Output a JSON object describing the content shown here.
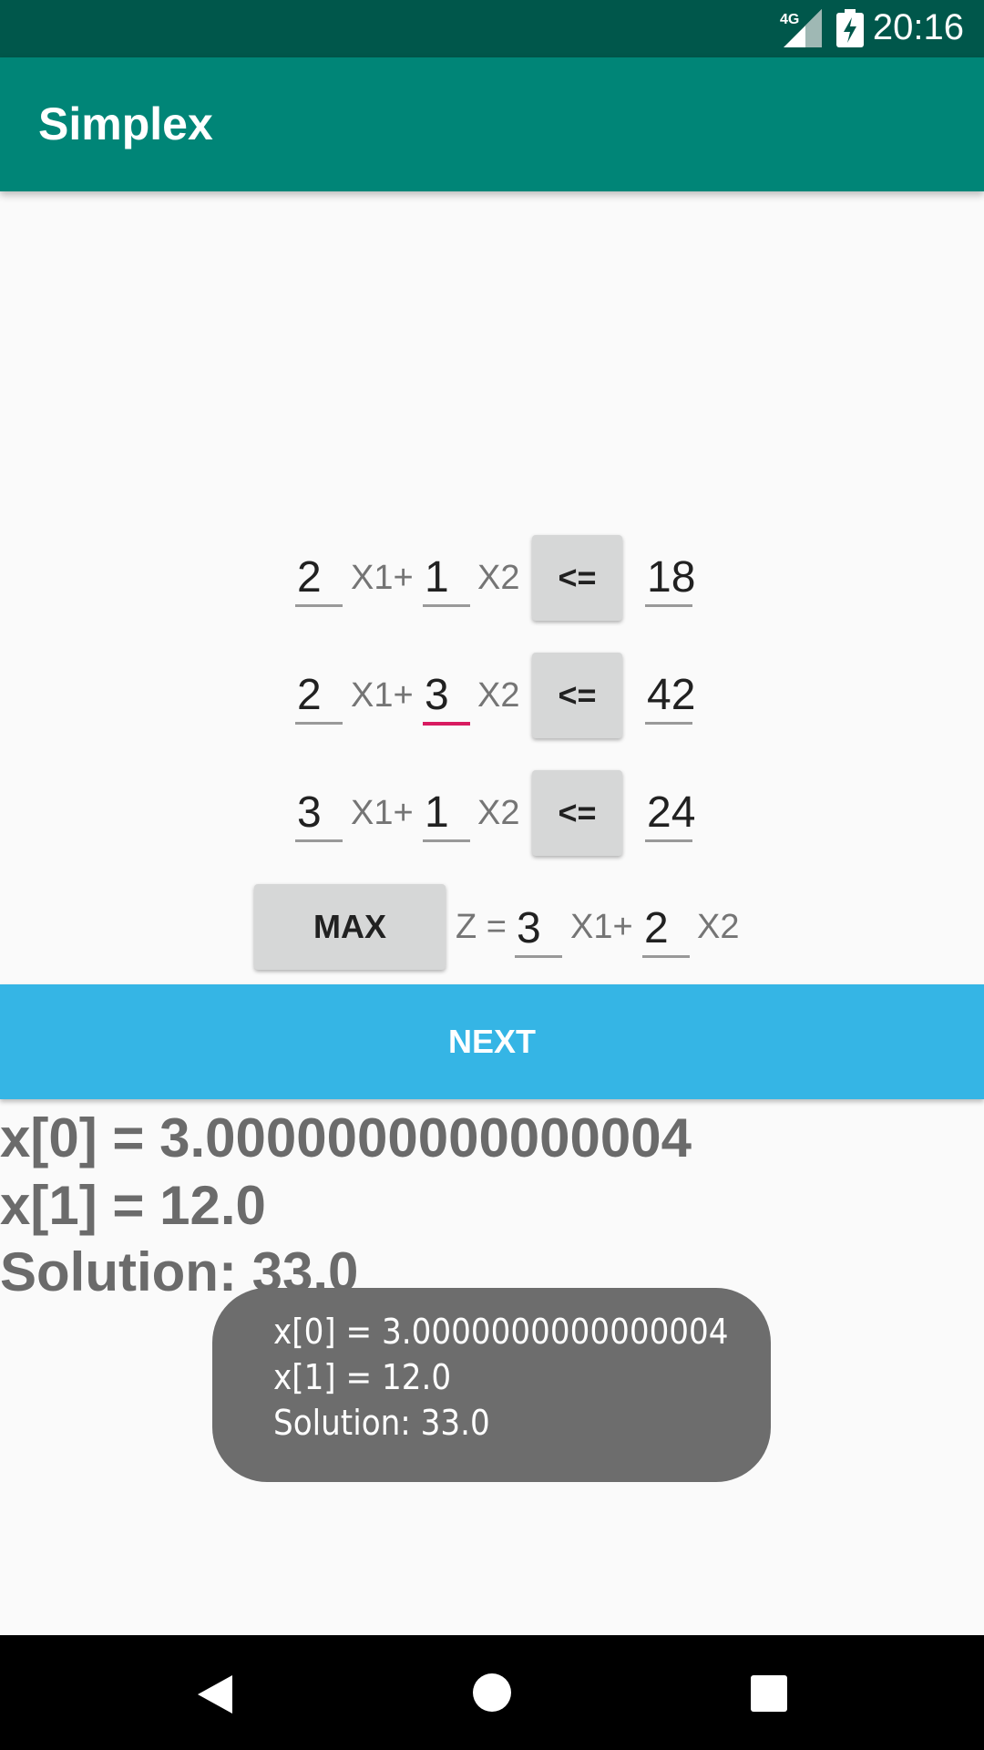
{
  "status_bar": {
    "network": "4G",
    "time": "20:16",
    "icons": [
      "signal-icon",
      "battery-charging-icon"
    ]
  },
  "app_bar": {
    "title": "Simplex"
  },
  "constraints": [
    {
      "a": "2",
      "x1_label": "X1+",
      "b": "1",
      "x2_label": "X2",
      "op": "<=",
      "rhs": "18"
    },
    {
      "a": "2",
      "x1_label": "X1+",
      "b": "3",
      "x2_label": "X2",
      "op": "<=",
      "rhs": "42"
    },
    {
      "a": "3",
      "x1_label": "X1+",
      "b": "1",
      "x2_label": "X2",
      "op": "<=",
      "rhs": "24"
    }
  ],
  "objective": {
    "mode_button": "MAX",
    "z_label": "Z =",
    "c1": "3",
    "x1_label": "X1+",
    "c2": "2",
    "x2_label": "X2"
  },
  "next_button": "NEXT",
  "results": {
    "x0": "x[0] = 3.0000000000000004",
    "x1": "x[1] = 12.0",
    "solution": "Solution: 33.0"
  },
  "toast": {
    "line1": "x[0] = 3.0000000000000004",
    "line2": "x[1] = 12.0",
    "line3": "Solution: 33.0"
  },
  "nav_bar": {
    "icons": [
      "back-icon",
      "home-icon",
      "recents-icon"
    ]
  },
  "colors": {
    "status_bar": "#00574b",
    "app_bar": "#008577",
    "accent": "#d81b60",
    "next_button": "#35b5e5"
  }
}
